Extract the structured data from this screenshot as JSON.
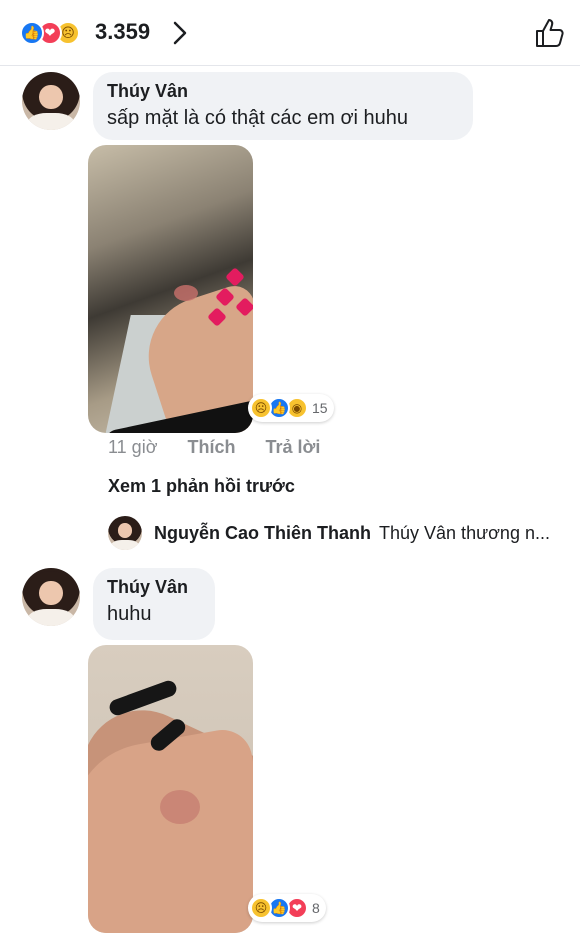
{
  "header": {
    "reaction_icons": [
      "like-icon",
      "love-icon",
      "sad-icon"
    ],
    "reaction_count": "3.359"
  },
  "comments": [
    {
      "author": "Thúy Vân",
      "text": "sấp mặt là có thật các em ơi huhu",
      "reaction_icons": [
        "sad-icon",
        "like-icon",
        "wow-icon"
      ],
      "reaction_count": "15",
      "time": "11 giờ",
      "like_label": "Thích",
      "reply_label": "Trả lời"
    },
    {
      "author": "Thúy Vân",
      "text": "huhu",
      "reaction_icons": [
        "sad-icon",
        "like-icon",
        "love-icon"
      ],
      "reaction_count": "8"
    }
  ],
  "view_previous": "Xem 1 phản hồi trước",
  "reply_preview": {
    "author": "Nguyễn Cao Thiên Thanh",
    "text": "Thúy Vân thương n..."
  },
  "colors": {
    "like": "#1877f2",
    "love": "#f33e58",
    "sad": "#f7c22f",
    "bubble": "#f0f2f5"
  }
}
